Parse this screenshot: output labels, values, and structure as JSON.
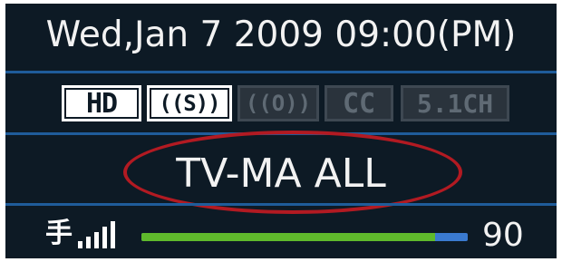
{
  "header": {
    "datetime": "Wed,Jan 7 2009 09:00(PM)"
  },
  "badges": [
    {
      "label": "HD",
      "active": true,
      "icon": "hd-badge"
    },
    {
      "label": "((S))",
      "active": true,
      "icon": "stereo-badge"
    },
    {
      "label": "((O))",
      "active": false,
      "icon": "surround-badge"
    },
    {
      "label": "CC",
      "active": false,
      "icon": "closed-caption-badge"
    },
    {
      "label": "5.1CH",
      "active": false,
      "icon": "five-one-channel-badge"
    }
  ],
  "rating": {
    "text": "TV-MA ALL",
    "highlight_color": "#b21a22"
  },
  "signal": {
    "icon": "antenna-signal-icon",
    "strength_value": "90",
    "strength_fraction": 0.9
  },
  "colors": {
    "panel_bg": "#0d1a25",
    "divider": "#1f5c9a",
    "meter_fill": "#5fba2c",
    "meter_track": "#3a7ad0"
  }
}
